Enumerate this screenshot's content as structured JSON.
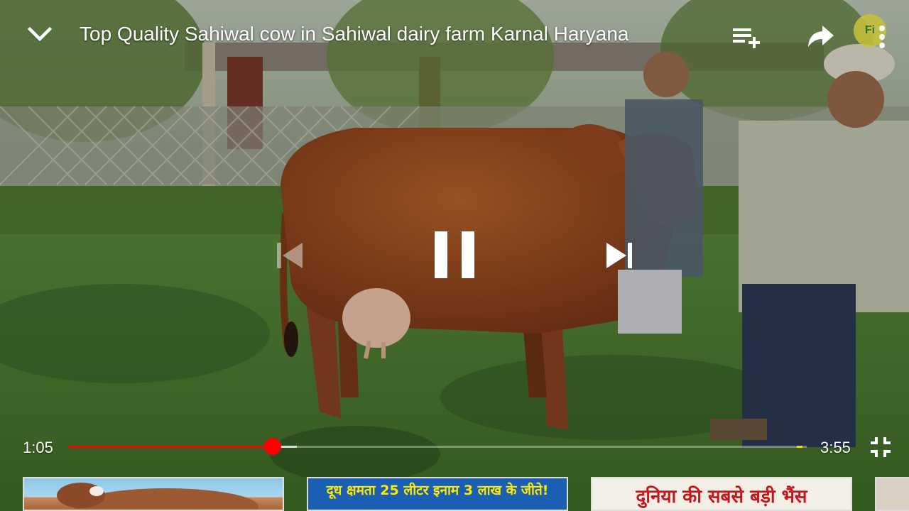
{
  "video": {
    "title": "Top Quality Sahiwal cow in Sahiwal dairy farm Karnal Haryana",
    "state": "playing"
  },
  "top_bar": {
    "collapse_icon": "chevron-down-icon",
    "playlist_icon": "playlist-add-icon",
    "share_icon": "share-icon",
    "more_icon": "more-vert-icon",
    "channel_logo_text": "Fi"
  },
  "controls": {
    "previous_icon": "skip-previous-icon",
    "pause_icon": "pause-icon",
    "next_icon": "skip-next-icon"
  },
  "seek": {
    "current_time": "1:05",
    "total_time": "3:55",
    "played_fraction": 0.2766,
    "buffered_fraction": 0.31,
    "ad_marker_fraction": 0.99,
    "played_color": "#ff0000",
    "fullscreen_icon": "fullscreen-exit-icon"
  },
  "related": [
    {
      "text": ""
    },
    {
      "text": "दूध क्षमता 25 लीटर इनाम 3 लाख के जीते!"
    },
    {
      "text": "दुनिया की सबसे बड़ी भैंस"
    },
    {
      "text": ""
    }
  ]
}
